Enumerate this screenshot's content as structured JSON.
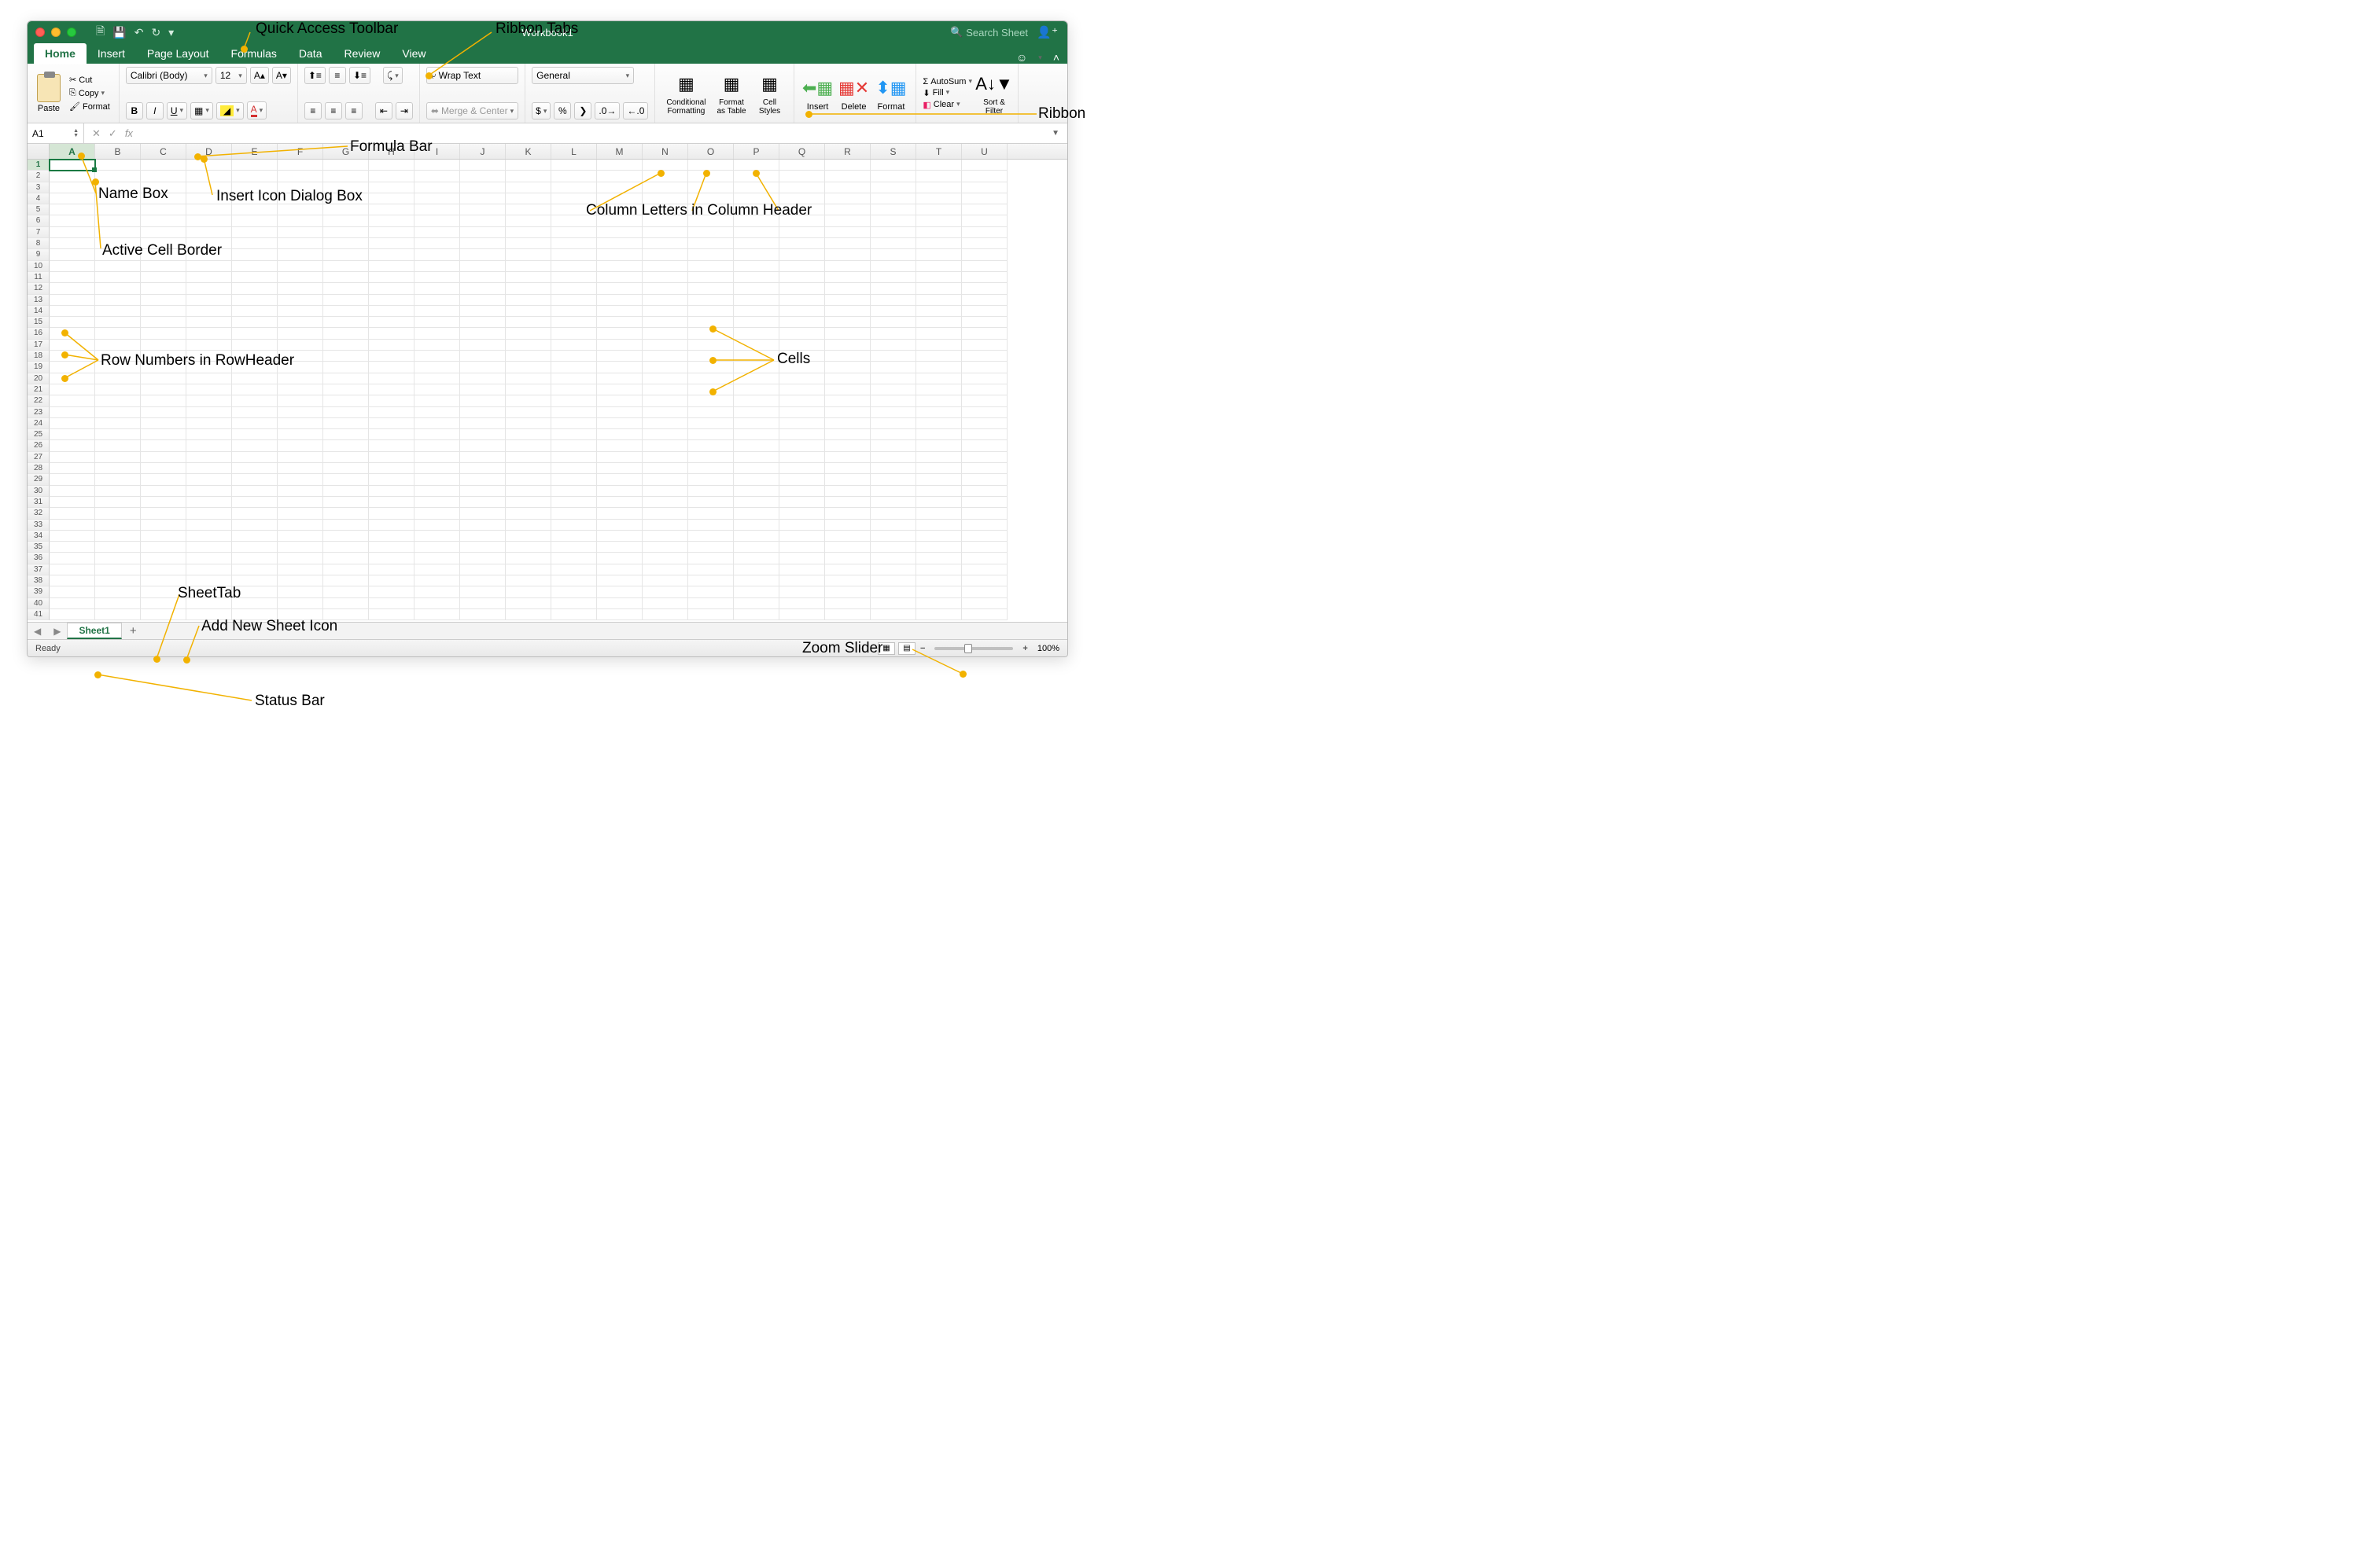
{
  "window": {
    "title": "Workbook1"
  },
  "search": {
    "placeholder": "Search Sheet"
  },
  "tabs": [
    "Home",
    "Insert",
    "Page Layout",
    "Formulas",
    "Data",
    "Review",
    "View"
  ],
  "active_tab": "Home",
  "clipboard": {
    "paste": "Paste",
    "cut": "Cut",
    "copy": "Copy",
    "format": "Format"
  },
  "font": {
    "name": "Calibri (Body)",
    "size": "12",
    "bold": "B",
    "italic": "I",
    "underline": "U"
  },
  "number": {
    "format": "General"
  },
  "wrap": "Wrap Text",
  "merge": "Merge & Center",
  "styles": {
    "cond": "Conditional Formatting",
    "table": "Format as Table",
    "cell": "Cell Styles"
  },
  "cells": {
    "insert": "Insert",
    "delete": "Delete",
    "format": "Format"
  },
  "editing": {
    "autosum": "AutoSum",
    "fill": "Fill",
    "clear": "Clear",
    "sortfilter": "Sort & Filter"
  },
  "namebox": "A1",
  "columns": [
    "A",
    "B",
    "C",
    "D",
    "E",
    "F",
    "G",
    "H",
    "I",
    "J",
    "K",
    "L",
    "M",
    "N",
    "O",
    "P",
    "Q",
    "R",
    "S",
    "T",
    "U"
  ],
  "rowcount": 41,
  "sheet": {
    "name": "Sheet1"
  },
  "status": {
    "ready": "Ready",
    "zoom": "100%"
  },
  "annotations": {
    "qat": "Quick Access Toolbar",
    "ribtabs": "Ribbon Tabs",
    "ribbon": "Ribbon",
    "fbar": "Formula Bar",
    "namebox": "Name Box",
    "insicon": "Insert Icon Dialog Box",
    "active": "Active Cell Border",
    "cols": "Column Letters in Column Header",
    "rows": "Row Numbers in RowHeader",
    "cells": "Cells",
    "sheettab": "SheetTab",
    "addsheet": "Add New Sheet Icon",
    "zoom": "Zoom Slider",
    "status": "Status Bar"
  }
}
